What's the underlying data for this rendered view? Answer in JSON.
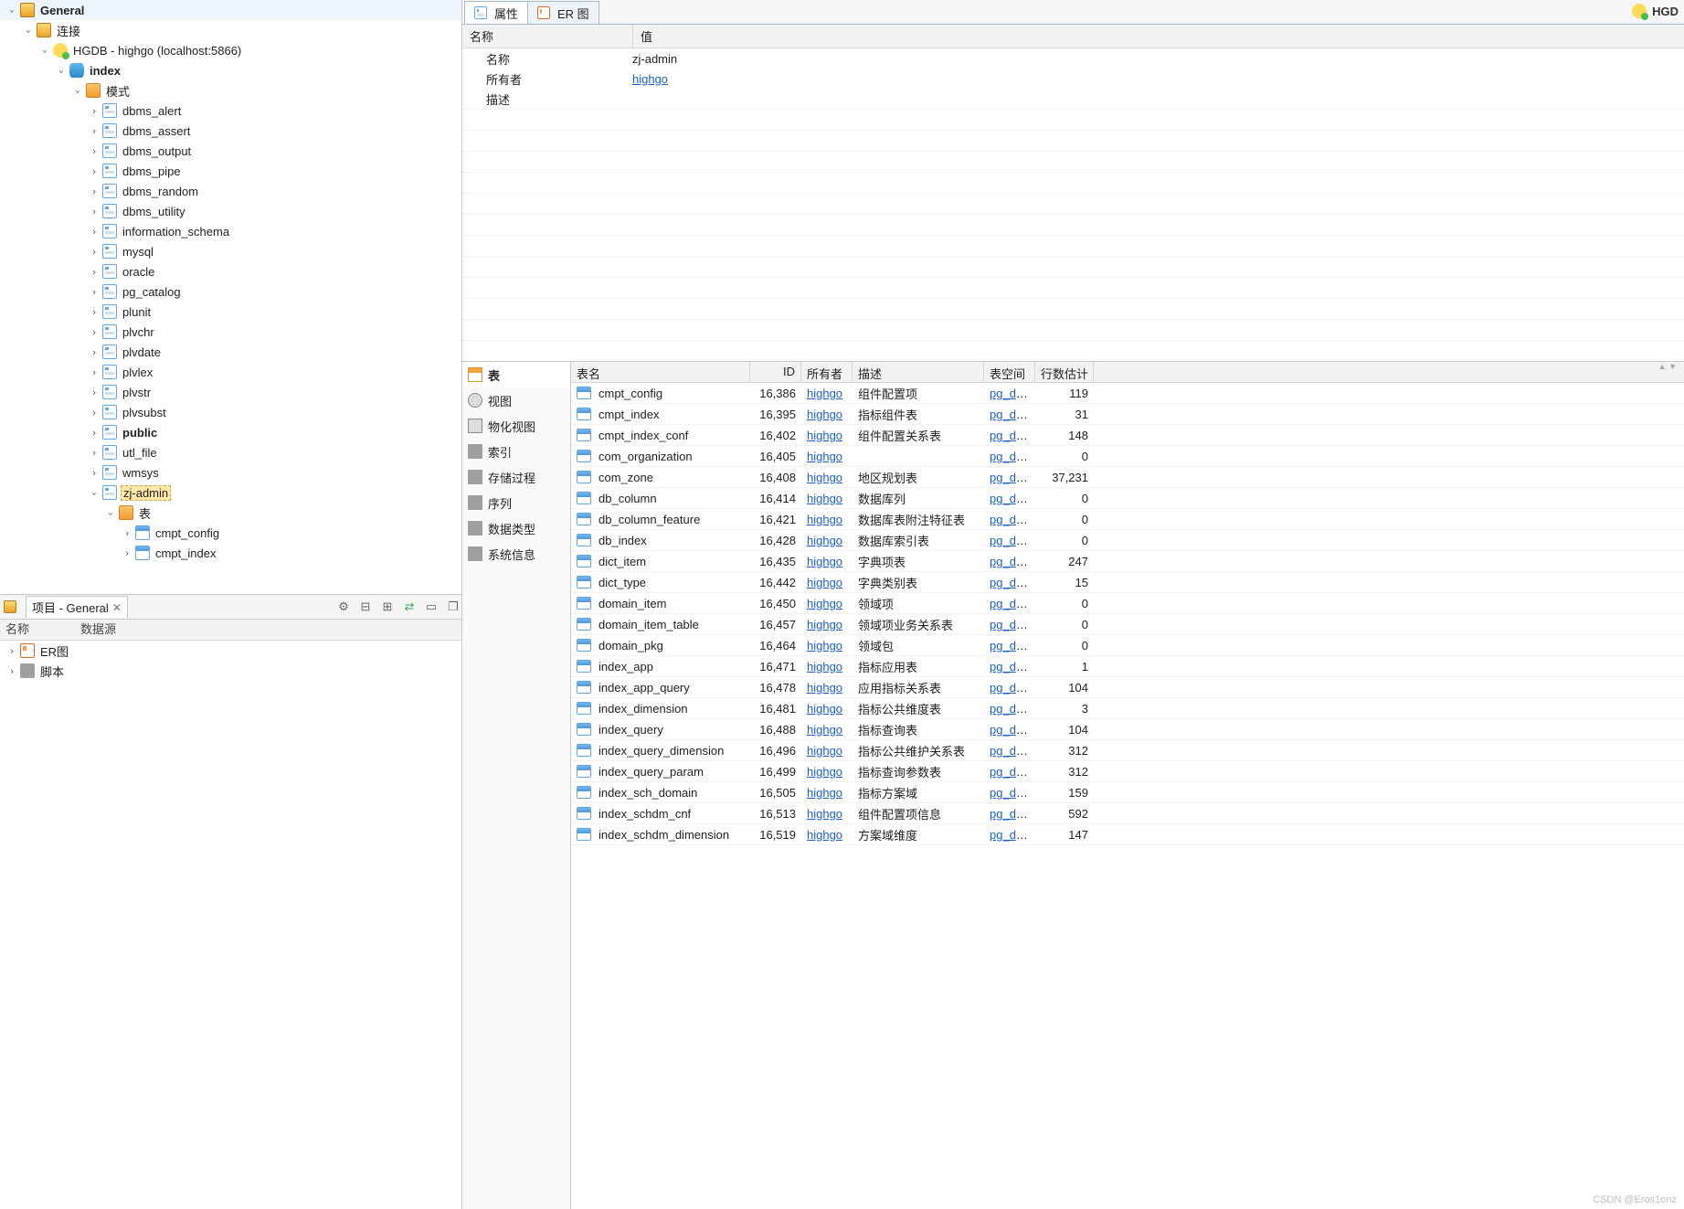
{
  "tree": {
    "root": {
      "label": "General",
      "icon": "book",
      "exp": true
    },
    "l1": {
      "label": "连接",
      "icon": "conn",
      "exp": true
    },
    "l2": {
      "label": "HGDB - highgo (localhost:5866)",
      "icon": "bee",
      "exp": true
    },
    "l3": {
      "label": "index",
      "icon": "db",
      "exp": true,
      "bold": true
    },
    "l4": {
      "label": "模式",
      "icon": "folder",
      "exp": true
    },
    "schemas": [
      "dbms_alert",
      "dbms_assert",
      "dbms_output",
      "dbms_pipe",
      "dbms_random",
      "dbms_utility",
      "information_schema",
      "mysql",
      "oracle",
      "pg_catalog",
      "plunit",
      "plvchr",
      "plvdate",
      "plvlex",
      "plvstr",
      "plvsubst"
    ],
    "public": {
      "label": "public",
      "icon": "schema",
      "bold": true,
      "expandable": true
    },
    "tail_schemas": [
      "utl_file",
      "wmsys"
    ],
    "zj": {
      "label": "zj-admin",
      "icon": "schema",
      "selected": true,
      "exp": true
    },
    "zj_tables": {
      "label": "表",
      "icon": "folder"
    },
    "zj_children": [
      "cmpt_config",
      "cmpt_index"
    ]
  },
  "project": {
    "tab": "项目 - General",
    "col1": "名称",
    "col2": "数据源",
    "items": [
      {
        "label": "ER图",
        "icon": "er"
      },
      {
        "label": "脚本",
        "icon": "fold2"
      }
    ]
  },
  "detailTabs": {
    "props": "属性",
    "er": "ER 图",
    "corner": "HGD"
  },
  "properties": {
    "header_name": "名称",
    "header_value": "值",
    "rows": [
      {
        "k": "名称",
        "v": "zj-admin"
      },
      {
        "k": "所有者",
        "v": "highgo",
        "link": true
      },
      {
        "k": "描述",
        "v": ""
      }
    ]
  },
  "sideItems": [
    {
      "key": "表",
      "icon": "table",
      "active": true
    },
    {
      "key": "视图",
      "icon": "view"
    },
    {
      "key": "物化视图",
      "icon": "mview"
    },
    {
      "key": "索引",
      "icon": "idx"
    },
    {
      "key": "存储过程",
      "icon": "sp"
    },
    {
      "key": "序列",
      "icon": "seq"
    },
    {
      "key": "数据类型",
      "icon": "type"
    },
    {
      "key": "系统信息",
      "icon": "sys"
    }
  ],
  "tableCols": {
    "name": "表名",
    "id": "ID",
    "owner": "所有者",
    "desc": "描述",
    "ts": "表空间",
    "rows": "行数估计"
  },
  "ownerLink": "highgo",
  "tsLink": "pg_defa",
  "tables": [
    {
      "n": "cmpt_config",
      "id": "16,386",
      "d": "组件配置项",
      "r": "119"
    },
    {
      "n": "cmpt_index",
      "id": "16,395",
      "d": "指标组件表",
      "r": "31"
    },
    {
      "n": "cmpt_index_conf",
      "id": "16,402",
      "d": "组件配置关系表",
      "r": "148"
    },
    {
      "n": "com_organization",
      "id": "16,405",
      "d": "",
      "r": "0"
    },
    {
      "n": "com_zone",
      "id": "16,408",
      "d": "地区规划表",
      "r": "37,231"
    },
    {
      "n": "db_column",
      "id": "16,414",
      "d": "数据库列",
      "r": "0"
    },
    {
      "n": "db_column_feature",
      "id": "16,421",
      "d": "数据库表附注特征表",
      "r": "0"
    },
    {
      "n": "db_index",
      "id": "16,428",
      "d": "数据库索引表",
      "r": "0"
    },
    {
      "n": "dict_item",
      "id": "16,435",
      "d": "字典项表",
      "r": "247"
    },
    {
      "n": "dict_type",
      "id": "16,442",
      "d": "字典类别表",
      "r": "15"
    },
    {
      "n": "domain_item",
      "id": "16,450",
      "d": "领域项",
      "r": "0"
    },
    {
      "n": "domain_item_table",
      "id": "16,457",
      "d": "领域项业务关系表",
      "r": "0"
    },
    {
      "n": "domain_pkg",
      "id": "16,464",
      "d": "领域包",
      "r": "0"
    },
    {
      "n": "index_app",
      "id": "16,471",
      "d": "指标应用表",
      "r": "1"
    },
    {
      "n": "index_app_query",
      "id": "16,478",
      "d": "应用指标关系表",
      "r": "104"
    },
    {
      "n": "index_dimension",
      "id": "16,481",
      "d": "指标公共维度表",
      "r": "3"
    },
    {
      "n": "index_query",
      "id": "16,488",
      "d": "指标查询表",
      "r": "104"
    },
    {
      "n": "index_query_dimension",
      "id": "16,496",
      "d": "指标公共维护关系表",
      "r": "312"
    },
    {
      "n": "index_query_param",
      "id": "16,499",
      "d": "指标查询参数表",
      "r": "312"
    },
    {
      "n": "index_sch_domain",
      "id": "16,505",
      "d": "指标方案域",
      "r": "159"
    },
    {
      "n": "index_schdm_cnf",
      "id": "16,513",
      "d": "组件配置项信息",
      "r": "592"
    },
    {
      "n": "index_schdm_dimension",
      "id": "16,519",
      "d": "方案域维度",
      "r": "147"
    }
  ],
  "watermark": "CSDN @Eros1onz"
}
